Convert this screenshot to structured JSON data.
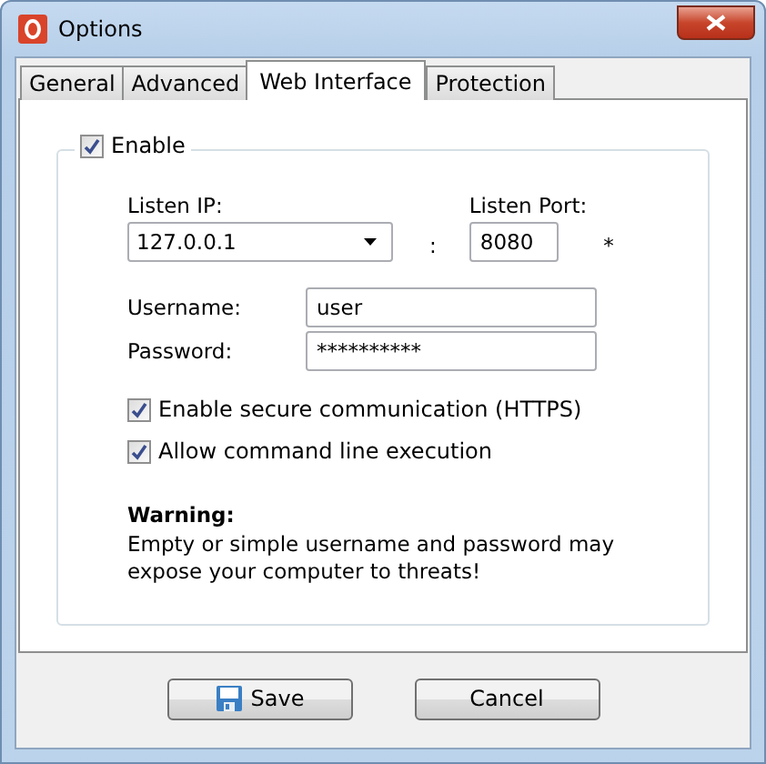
{
  "window": {
    "title": "Options"
  },
  "tabs": [
    {
      "label": "General",
      "selected": false
    },
    {
      "label": "Advanced",
      "selected": false
    },
    {
      "label": "Web Interface",
      "selected": true
    },
    {
      "label": "Protection",
      "selected": false
    }
  ],
  "enable": {
    "label": "Enable",
    "checked": true
  },
  "listen_ip": {
    "label": "Listen IP:",
    "value": "127.0.0.1"
  },
  "separator": ":",
  "listen_port": {
    "label": "Listen Port:",
    "value": "8080",
    "required_mark": "*"
  },
  "username": {
    "label": "Username:",
    "value": "user"
  },
  "password": {
    "label": "Password:",
    "value": "**********"
  },
  "options": [
    {
      "label": "Enable secure communication (HTTPS)",
      "checked": true
    },
    {
      "label": "Allow command line execution",
      "checked": true
    }
  ],
  "warning": {
    "title": "Warning:",
    "text": "Empty or simple username and password may expose your computer to threats!"
  },
  "buttons": [
    {
      "label": "Save",
      "kind": "save"
    },
    {
      "label": "Cancel",
      "kind": "plain"
    }
  ]
}
